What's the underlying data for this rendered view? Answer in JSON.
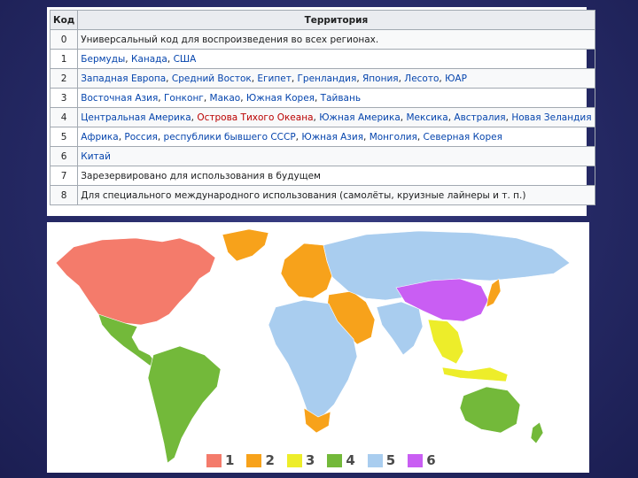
{
  "table": {
    "headers": {
      "code": "Код",
      "territory": "Территория"
    },
    "rows": [
      {
        "code": "0",
        "parts": [
          {
            "text": "Универсальный код для воспроизведения во всех регионах.",
            "link": false
          }
        ]
      },
      {
        "code": "1",
        "parts": [
          {
            "text": "Бермуды",
            "link": true
          },
          {
            "text": ", ",
            "link": false
          },
          {
            "text": "Канада",
            "link": true
          },
          {
            "text": ", ",
            "link": false
          },
          {
            "text": "США",
            "link": true
          }
        ]
      },
      {
        "code": "2",
        "parts": [
          {
            "text": "Западная Европа",
            "link": true
          },
          {
            "text": ", ",
            "link": false
          },
          {
            "text": "Средний Восток",
            "link": true
          },
          {
            "text": ", ",
            "link": false
          },
          {
            "text": "Египет",
            "link": true
          },
          {
            "text": ", ",
            "link": false
          },
          {
            "text": "Гренландия",
            "link": true
          },
          {
            "text": ", ",
            "link": false
          },
          {
            "text": "Япония",
            "link": true
          },
          {
            "text": ", ",
            "link": false
          },
          {
            "text": "Лесото",
            "link": true
          },
          {
            "text": ", ",
            "link": false
          },
          {
            "text": "ЮАР",
            "link": true
          }
        ]
      },
      {
        "code": "3",
        "parts": [
          {
            "text": "Восточная Азия",
            "link": true
          },
          {
            "text": ", ",
            "link": false
          },
          {
            "text": "Гонконг",
            "link": true
          },
          {
            "text": ", ",
            "link": false
          },
          {
            "text": "Макао",
            "link": true
          },
          {
            "text": ", ",
            "link": false
          },
          {
            "text": "Южная Корея",
            "link": true
          },
          {
            "text": ", ",
            "link": false
          },
          {
            "text": "Тайвань",
            "link": true
          }
        ]
      },
      {
        "code": "4",
        "parts": [
          {
            "text": "Центральная Америка",
            "link": true
          },
          {
            "text": ", ",
            "link": false
          },
          {
            "text": "Острова Тихого Океана",
            "link": true,
            "red": true
          },
          {
            "text": ", ",
            "link": false
          },
          {
            "text": "Южная Америка",
            "link": true
          },
          {
            "text": ", ",
            "link": false
          },
          {
            "text": "Мексика",
            "link": true
          },
          {
            "text": ", ",
            "link": false
          },
          {
            "text": "Австралия",
            "link": true
          },
          {
            "text": ", ",
            "link": false
          },
          {
            "text": "Новая Зеландия",
            "link": true
          }
        ]
      },
      {
        "code": "5",
        "parts": [
          {
            "text": "Африка",
            "link": true
          },
          {
            "text": ", ",
            "link": false
          },
          {
            "text": "Россия",
            "link": true
          },
          {
            "text": ", ",
            "link": false
          },
          {
            "text": "республики бывшего СССР",
            "link": true
          },
          {
            "text": ", ",
            "link": false
          },
          {
            "text": "Южная Азия",
            "link": true
          },
          {
            "text": ", ",
            "link": false
          },
          {
            "text": "Монголия",
            "link": true
          },
          {
            "text": ", ",
            "link": false
          },
          {
            "text": "Северная Корея",
            "link": true
          }
        ]
      },
      {
        "code": "6",
        "parts": [
          {
            "text": "Китай",
            "link": true
          }
        ]
      },
      {
        "code": "7",
        "parts": [
          {
            "text": "Зарезервировано для использования в будущем",
            "link": false
          }
        ]
      },
      {
        "code": "8",
        "parts": [
          {
            "text": "Для специального международного использования (самолёты, круизные лайнеры и т. п.)",
            "link": false
          }
        ]
      }
    ]
  },
  "map": {
    "legend": [
      {
        "label": "1",
        "color": "#f47b6b"
      },
      {
        "label": "2",
        "color": "#f7a21b"
      },
      {
        "label": "3",
        "color": "#eded2a"
      },
      {
        "label": "4",
        "color": "#73b93a"
      },
      {
        "label": "5",
        "color": "#a9cdef"
      },
      {
        "label": "6",
        "color": "#c95ef3"
      }
    ]
  }
}
